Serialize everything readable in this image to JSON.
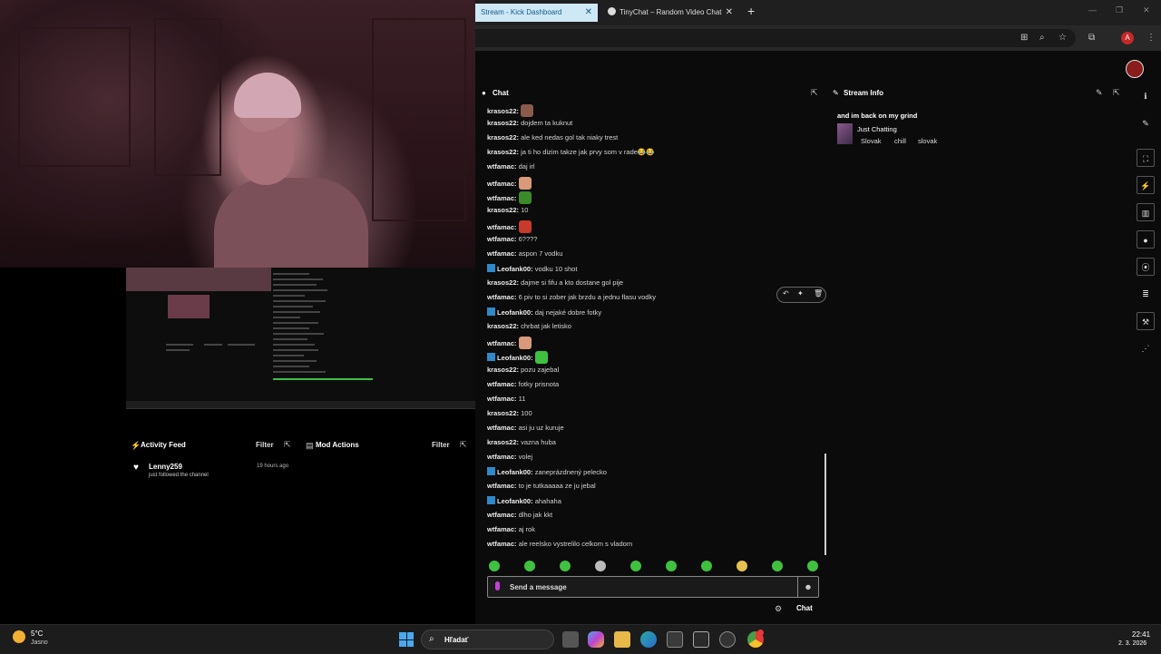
{
  "activity_feed": {
    "title": "Activity Feed",
    "filter_label": "Filter",
    "items": [
      {
        "user": "Lenny259",
        "action": "just followed the channel",
        "time": "19 hours ago"
      }
    ]
  },
  "mod_actions": {
    "title": "Mod Actions",
    "filter_label": "Filter"
  },
  "browser": {
    "tabs": [
      {
        "label": "Stream - Kick Dashboard"
      },
      {
        "label": "TinyChat – Random Video Chat"
      }
    ]
  },
  "chat": {
    "title": "Chat",
    "messages": [
      {
        "user": "krasos22",
        "text": "",
        "emote_color": "#8a5a4a"
      },
      {
        "user": "krasos22",
        "text": "dojdem ta kuknut"
      },
      {
        "user": "krasos22",
        "text": "ale ked nedas gol tak niaky trest"
      },
      {
        "user": "krasos22",
        "text": "ja ti ho dizim takze jak prvy som v rade😂😂"
      },
      {
        "user": "wtfamac",
        "text": "daj irl"
      },
      {
        "user": "wtfamac",
        "text": "",
        "emote_color": "#d89a7a"
      },
      {
        "user": "wtfamac",
        "text": "",
        "emote_color": "#3a8a2a"
      },
      {
        "user": "krasos22",
        "text": "10"
      },
      {
        "user": "wtfamac",
        "text": "",
        "emote_color": "#c83a2a"
      },
      {
        "user": "wtfamac",
        "text": "6????"
      },
      {
        "user": "wtfamac",
        "text": "aspon 7 vodku"
      },
      {
        "user": "Leofank00",
        "text": "vodku 10 shot",
        "badge": true
      },
      {
        "user": "krasos22",
        "text": "dajme si fifu a kto dostane gol pije"
      },
      {
        "user": "wtfamac",
        "text": "6 piv to si zober jak brzdu a jednu flasu vodky"
      },
      {
        "user": "Leofank00",
        "text": "daj nejaké dobre fotky",
        "badge": true
      },
      {
        "user": "krasos22",
        "text": "chrbat jak letisko"
      },
      {
        "user": "wtfamac",
        "text": "",
        "emote_color": "#d89a7a"
      },
      {
        "user": "Leofank00",
        "text": "",
        "badge": true,
        "emote_color": "#3fc13f"
      },
      {
        "user": "krasos22",
        "text": "pozu zajebal"
      },
      {
        "user": "wtfamac",
        "text": "fotky prisnota"
      },
      {
        "user": "wtfamac",
        "text": "11"
      },
      {
        "user": "krasos22",
        "text": "100"
      },
      {
        "user": "wtfamac",
        "text": "asi ju uz kuruje"
      },
      {
        "user": "krasos22",
        "text": "vazna huba"
      },
      {
        "user": "wtfamac",
        "text": "volej"
      },
      {
        "user": "Leofank00",
        "text": "zaneprázdnený pelecko",
        "badge": true
      },
      {
        "user": "wtfamac",
        "text": "to je tutkaaaaa ze ju jebal"
      },
      {
        "user": "Leofank00",
        "text": "ahahaha",
        "badge": true
      },
      {
        "user": "wtfamac",
        "text": "dlho jak kkt"
      },
      {
        "user": "wtfamac",
        "text": "aj rok"
      },
      {
        "user": "wtfamac",
        "text": "ale reelsko vystrelilo celkom s vladom"
      }
    ],
    "send_placeholder": "Send a message",
    "footer_label": "Chat"
  },
  "stream_info": {
    "title": "Stream Info",
    "stream_title": "and im back on my grind",
    "category": "Just Chatting",
    "tags": [
      "Slovak",
      "chill",
      "slovak"
    ]
  },
  "taskbar": {
    "weather_temp": "5°C",
    "weather_desc": "Jasno",
    "search_placeholder": "Hľadať",
    "time": "22:41",
    "date": "2. 3. 2026"
  },
  "colors": {
    "kick_green": "#3fc13f",
    "tab_active_bg": "#cfe8f6",
    "badge_blue": "#2f88c9",
    "mic_purple": "#c042d0"
  }
}
